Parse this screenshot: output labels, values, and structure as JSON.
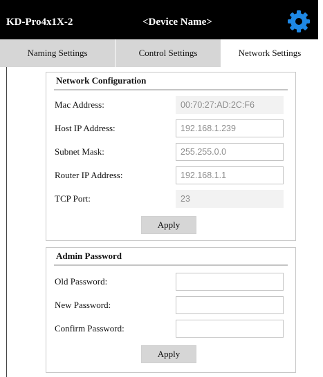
{
  "header": {
    "model": "KD-Pro4x1X-2",
    "device_name": "<Device Name>",
    "settings_icon": "gear-icon",
    "accent": "#1e88e5"
  },
  "tabs": [
    {
      "label": "Naming Settings",
      "active": false
    },
    {
      "label": "Control Settings",
      "active": false
    },
    {
      "label": "Network Settings",
      "active": true
    }
  ],
  "network": {
    "title": "Network Configuration",
    "fields": [
      {
        "label": "Mac Address:",
        "value": "00:70:27:AD:2C:F6",
        "readonly": true
      },
      {
        "label": "Host IP Address:",
        "value": "192.168.1.239",
        "readonly": false
      },
      {
        "label": "Subnet Mask:",
        "value": "255.255.0.0",
        "readonly": false
      },
      {
        "label": "Router IP Address:",
        "value": "192.168.1.1",
        "readonly": false
      },
      {
        "label": "TCP Port:",
        "value": "23",
        "readonly": true
      }
    ],
    "apply_label": "Apply"
  },
  "admin": {
    "title": "Admin Password",
    "fields": [
      {
        "label": "Old Password:",
        "value": ""
      },
      {
        "label": "New Password:",
        "value": ""
      },
      {
        "label": "Confirm Password:",
        "value": ""
      }
    ],
    "apply_label": "Apply"
  }
}
